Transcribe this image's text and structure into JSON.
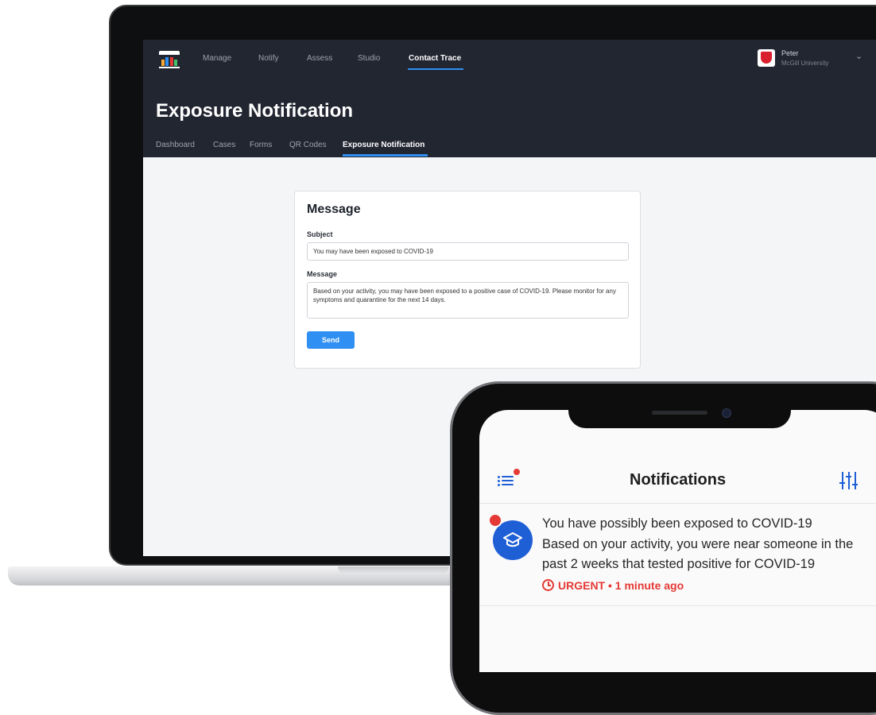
{
  "web": {
    "nav": [
      "Manage",
      "Notify",
      "Assess",
      "Studio",
      "Contact Trace"
    ],
    "active_nav": "Contact Trace",
    "user": {
      "name": "Peter",
      "org": "McGill University"
    },
    "page_title": "Exposure Notification",
    "subnav": [
      "Dashboard",
      "Cases",
      "Forms",
      "QR Codes",
      "Exposure Notification"
    ],
    "active_subnav": "Exposure Notification",
    "form": {
      "title": "Message",
      "subject_label": "Subject",
      "subject_value": "You may have been exposed to COVID-19",
      "message_label": "Message",
      "message_value": "Based on your activity, you may have been exposed to a positive case of COVID-19. Please monitor for any symptoms and quarantine for the next 14 days.",
      "send_label": "Send"
    }
  },
  "mobile": {
    "title": "Notifications",
    "notification": {
      "headline": "You have possibly been exposed to COVID-19",
      "body_line1": "Based on your activity, you were near someone in the",
      "body_line2": "past 2 weeks that tested positive for COVID-19",
      "priority": "URGENT",
      "time": "• 1 minute ago"
    }
  },
  "colors": {
    "topbar": "#222631",
    "accent": "#2f8ff2",
    "mobile_accent": "#1f5fd6",
    "urgent": "#e53935"
  },
  "icons": [
    "logo-icon",
    "chevron-down-icon",
    "university-crest-icon",
    "menu-list-icon",
    "filter-sliders-icon",
    "graduation-cap-icon",
    "clock-icon"
  ]
}
